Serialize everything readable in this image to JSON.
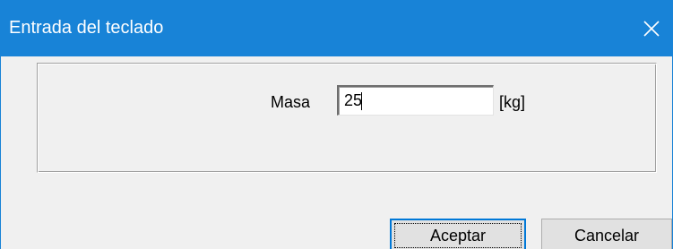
{
  "window": {
    "title": "Entrada del teclado",
    "close_symbol": "×"
  },
  "form": {
    "field_label": "Masa",
    "field_value": "25",
    "unit": "[kg]"
  },
  "buttons": {
    "accept_label": "Aceptar",
    "cancel_label": "Cancelar"
  },
  "colors": {
    "titlebar": "#1883d7",
    "title_text": "#ffffff",
    "dialog_bg": "#f0f0f0",
    "default_button_border": "#0078d7"
  },
  "icons": {
    "close": "close-icon"
  }
}
